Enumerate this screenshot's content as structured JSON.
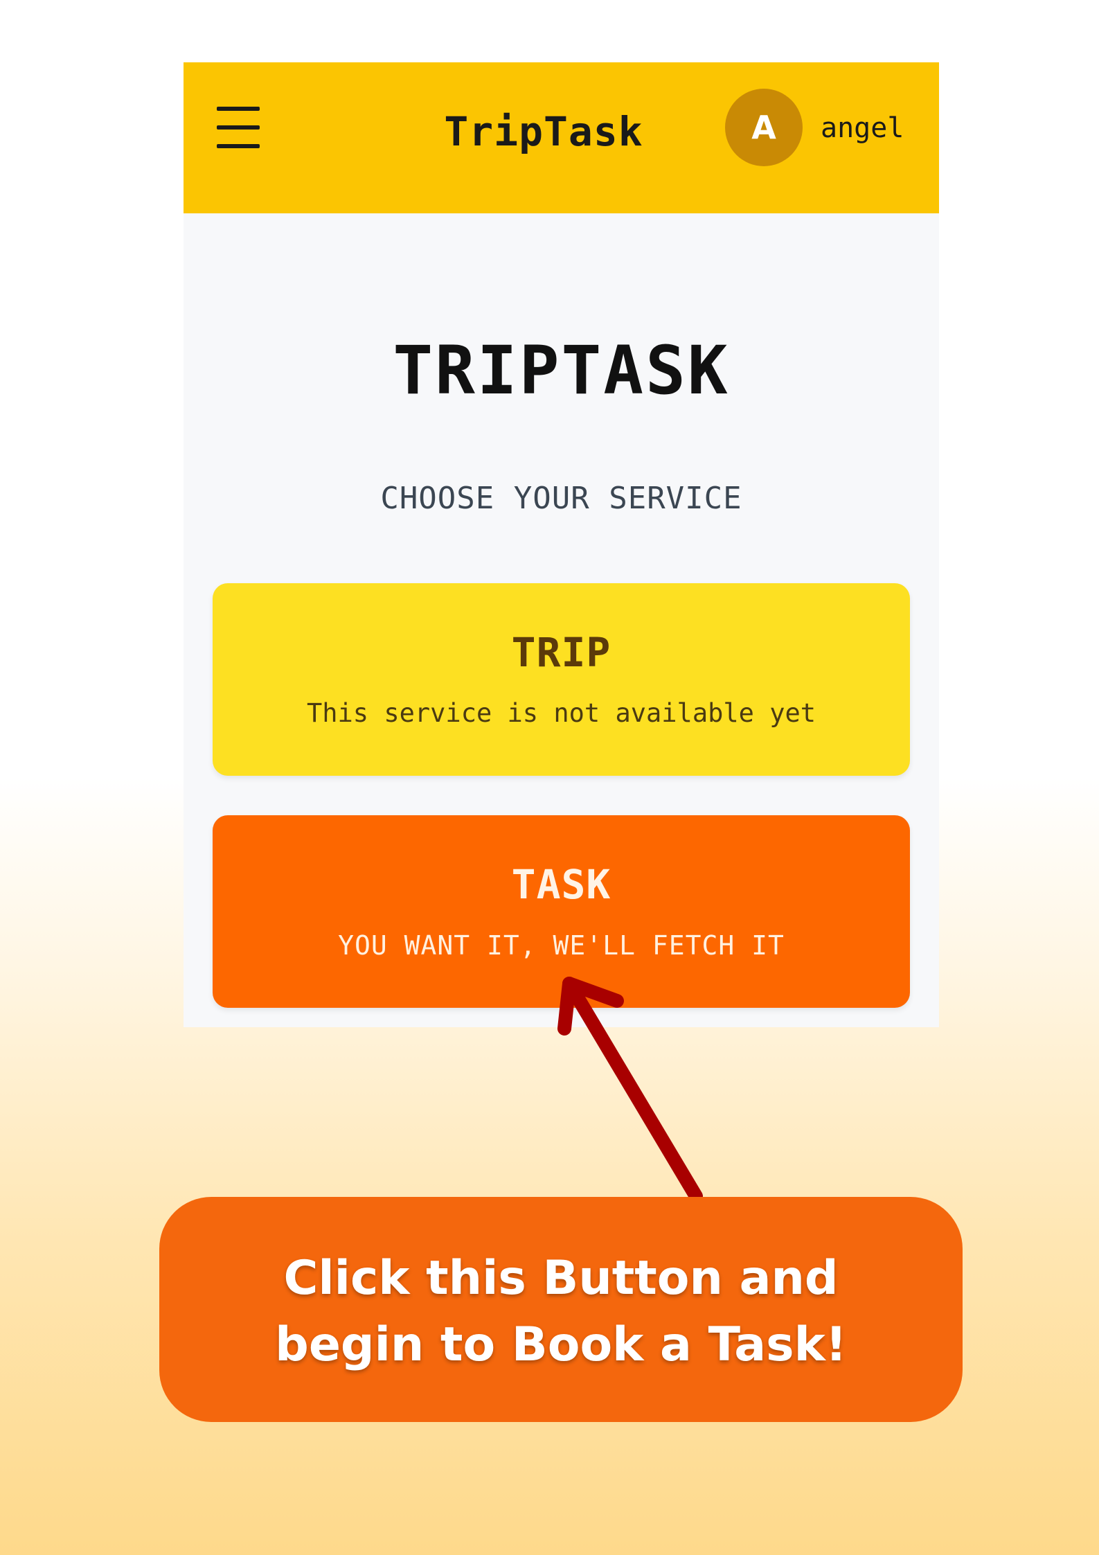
{
  "header": {
    "app_name": "TripTask",
    "avatar_initial": "A",
    "username": "angel"
  },
  "hero": {
    "brand": "TRIPTASK",
    "subtitle": "CHOOSE YOUR SERVICE"
  },
  "services": [
    {
      "title": "TRIP",
      "description": "This service is not available yet"
    },
    {
      "title": "TASK",
      "description": "YOU WANT IT, WE'LL FETCH IT"
    }
  ],
  "callout": {
    "line1": "Click this Button and",
    "line2": "begin to Book a Task!"
  },
  "colors": {
    "header_bg": "#fbc502",
    "trip_card": "#fde022",
    "task_card": "#fd6700",
    "callout_bg": "#f4670d",
    "arrow": "#a80000",
    "avatar_bg": "#c98a05"
  },
  "icons": [
    "hamburger-menu-icon",
    "arrow-pointer-icon"
  ]
}
